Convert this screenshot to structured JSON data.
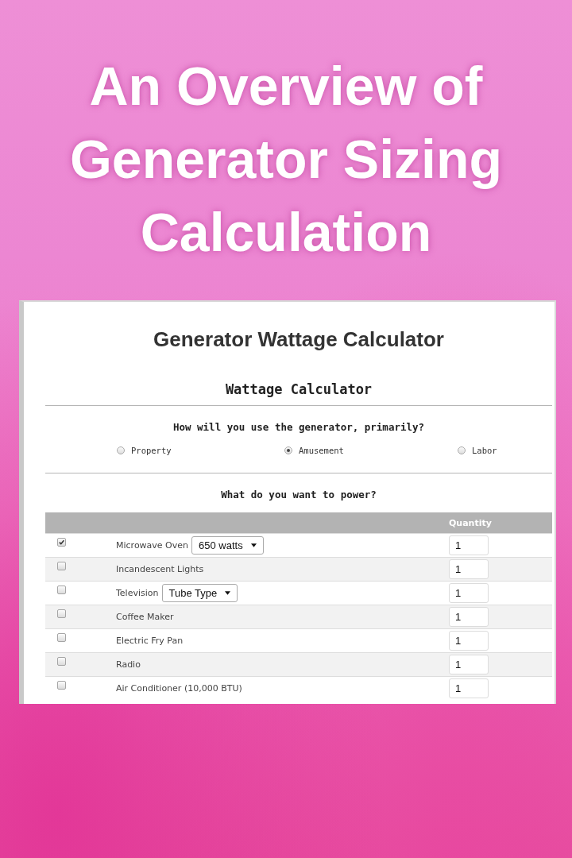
{
  "headline": [
    "An Overview of",
    "Generator Sizing",
    "Calculation"
  ],
  "calculator": {
    "page_title": "Generator Wattage Calculator",
    "section_title": "Wattage Calculator",
    "usage_question": "How will you use the generator, primarily?",
    "usage_options": [
      {
        "label": "Property",
        "selected": false
      },
      {
        "label": "Amusement",
        "selected": true
      },
      {
        "label": "Labor",
        "selected": false
      }
    ],
    "power_question": "What do you want to power?",
    "table": {
      "columns": [
        "Quantity"
      ],
      "rows": [
        {
          "name": "Microwave Oven",
          "checked": true,
          "option": "650 watts",
          "quantity": "1"
        },
        {
          "name": "Incandescent Lights",
          "checked": false,
          "quantity": "1"
        },
        {
          "name": "Television",
          "checked": false,
          "option": "Tube Type",
          "quantity": "1"
        },
        {
          "name": "Coffee Maker",
          "checked": false,
          "quantity": "1"
        },
        {
          "name": "Electric Fry Pan",
          "checked": false,
          "quantity": "1"
        },
        {
          "name": "Radio",
          "checked": false,
          "quantity": "1"
        },
        {
          "name": "Air Conditioner (10,000 BTU)",
          "checked": false,
          "quantity": "1"
        }
      ]
    }
  }
}
